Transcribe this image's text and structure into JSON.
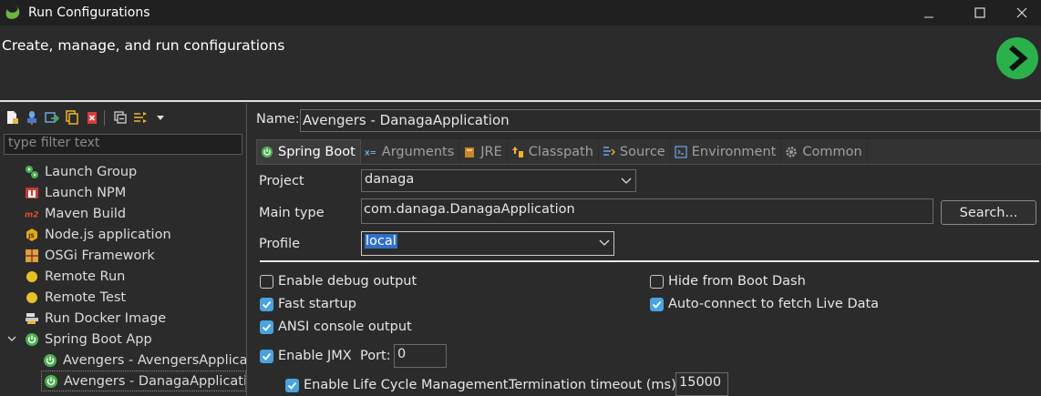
{
  "window": {
    "title": "Run Configurations",
    "subtitle": "Create, manage, and run configurations"
  },
  "sidebar": {
    "filter_placeholder": "type filter text",
    "items": [
      {
        "label": "Launch Group",
        "icon": "launch-group-icon"
      },
      {
        "label": "Launch NPM",
        "icon": "npm-icon"
      },
      {
        "label": "Maven Build",
        "icon": "maven-icon"
      },
      {
        "label": "Node.js application",
        "icon": "nodejs-icon"
      },
      {
        "label": "OSGi Framework",
        "icon": "osgi-icon"
      },
      {
        "label": "Remote Run",
        "icon": "remote-run-icon"
      },
      {
        "label": "Remote Test",
        "icon": "remote-test-icon"
      },
      {
        "label": "Run Docker Image",
        "icon": "docker-icon"
      },
      {
        "label": "Spring Boot App",
        "icon": "spring-boot-icon"
      },
      {
        "label": "Avengers - AvengersApplica",
        "icon": "spring-boot-icon"
      },
      {
        "label": "Avengers - DanagaApplicati",
        "icon": "spring-boot-icon"
      }
    ]
  },
  "form": {
    "name_label": "Name:",
    "name_value": "Avengers - DanagaApplication",
    "tabs": [
      {
        "label": "Spring Boot",
        "icon": "spring-boot-icon"
      },
      {
        "label": "Arguments",
        "icon": "arguments-icon"
      },
      {
        "label": "JRE",
        "icon": "jre-icon"
      },
      {
        "label": "Classpath",
        "icon": "classpath-icon"
      },
      {
        "label": "Source",
        "icon": "source-icon"
      },
      {
        "label": "Environment",
        "icon": "environment-icon"
      },
      {
        "label": "Common",
        "icon": "gear-icon"
      }
    ],
    "project_label": "Project",
    "project_value": "danaga",
    "main_type_label": "Main type",
    "main_type_value": "com.danaga.DanagaApplication",
    "search_button": "Search...",
    "profile_label": "Profile",
    "profile_value": "local",
    "options": {
      "debug_output": {
        "label": "Enable debug output",
        "checked": false
      },
      "hide_boot_dash": {
        "label": "Hide from Boot Dash",
        "checked": false
      },
      "fast_startup": {
        "label": "Fast startup",
        "checked": true
      },
      "auto_connect": {
        "label": "Auto-connect to fetch Live Data",
        "checked": true
      },
      "ansi_output": {
        "label": "ANSI console output",
        "checked": true
      },
      "enable_jmx": {
        "label": "Enable JMX",
        "checked": true
      },
      "port_label": "Port:",
      "port_value": "0",
      "lifecycle": {
        "label": "Enable Life Cycle Management.",
        "checked": true
      },
      "termination_label": "Termination timeout (ms):",
      "termination_value": "15000"
    }
  },
  "colors": {
    "background": "#2b2b2b",
    "checkbox_accent": "#4aa3df",
    "spring_green": "#6db33f",
    "run_green": "#2bb14c"
  }
}
